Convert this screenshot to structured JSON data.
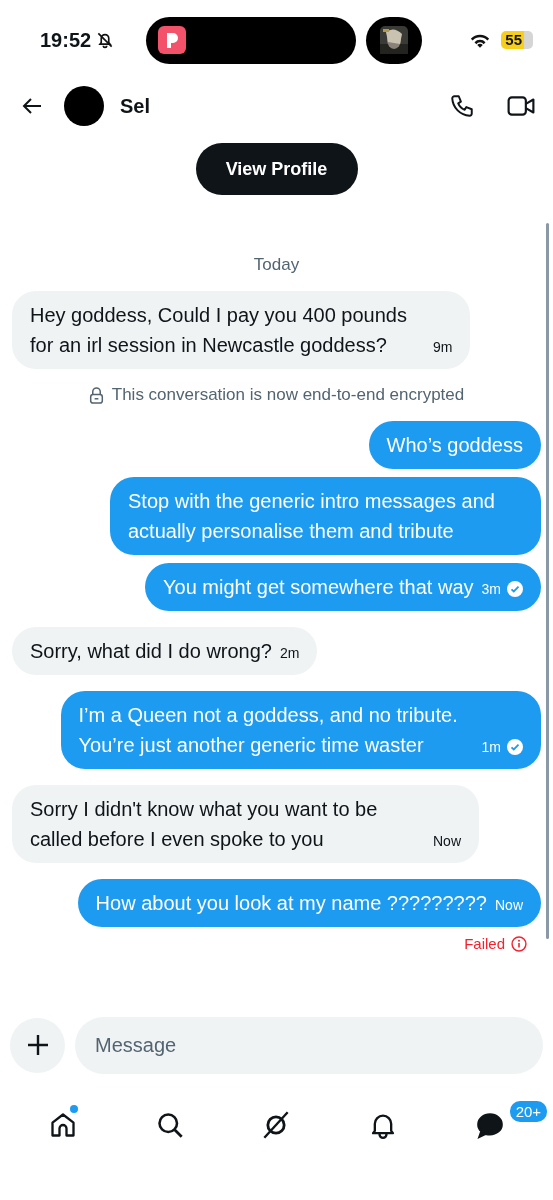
{
  "status_bar": {
    "time": "19:52",
    "battery": "55"
  },
  "header": {
    "contact_name": "Sel"
  },
  "view_profile_button": "View Profile",
  "messages": [
    {
      "kind": "date",
      "text": "Today"
    },
    {
      "kind": "received",
      "text": "Hey goddess, Could I pay you 400 pounds for an irl session in Newcastle goddess?",
      "time": "9m"
    },
    {
      "kind": "notice",
      "text": "This conversation is now end-to-end encrypted"
    },
    {
      "kind": "sent",
      "text": "Who’s goddess"
    },
    {
      "kind": "sent",
      "text": "Stop with the generic intro messages and actually personalise them and tribute"
    },
    {
      "kind": "sent",
      "text": "You might get somewhere that way",
      "time": "3m",
      "read": true
    },
    {
      "kind": "received",
      "text": "Sorry, what did I do wrong?",
      "time": "2m"
    },
    {
      "kind": "sent",
      "text": "I’m a Queen not a goddess, and no tribute. You’re just another generic time waster",
      "time": "1m",
      "read": true
    },
    {
      "kind": "received",
      "text": "Sorry I didn't know what you want to be called before I even spoke to you",
      "time": "Now"
    },
    {
      "kind": "sent",
      "text": "How about you look at my name ?????????",
      "time": "Now",
      "status": "Failed"
    }
  ],
  "composer": {
    "placeholder": "Message"
  },
  "nav": [
    {
      "kind": "home",
      "selected": false,
      "dot": true
    },
    {
      "kind": "search",
      "selected": false
    },
    {
      "kind": "grok",
      "selected": false
    },
    {
      "kind": "notifications",
      "selected": false
    },
    {
      "kind": "messages",
      "selected": true,
      "badge": "20+"
    }
  ]
}
